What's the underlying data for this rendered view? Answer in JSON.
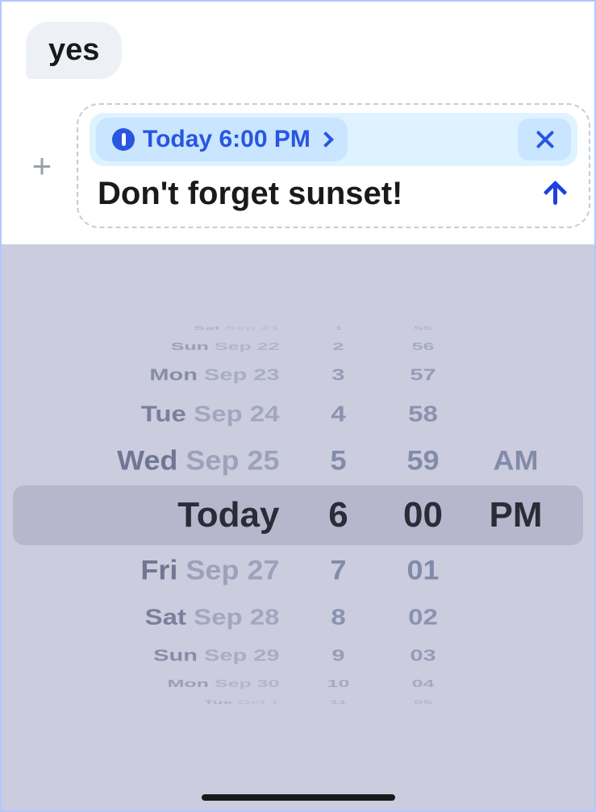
{
  "chat": {
    "incoming_message": "yes"
  },
  "compose": {
    "reminder_label": "Today 6:00 PM",
    "message": "Don't forget sunset!"
  },
  "picker": {
    "rows_before": [
      {
        "dow": "Sat",
        "md": "Sep 21",
        "hour": "1",
        "min": "55",
        "ampm": ""
      },
      {
        "dow": "Sun",
        "md": "Sep 22",
        "hour": "2",
        "min": "56",
        "ampm": ""
      },
      {
        "dow": "Mon",
        "md": "Sep 23",
        "hour": "3",
        "min": "57",
        "ampm": ""
      },
      {
        "dow": "Tue",
        "md": "Sep 24",
        "hour": "4",
        "min": "58",
        "ampm": ""
      },
      {
        "dow": "Wed",
        "md": "Sep 25",
        "hour": "5",
        "min": "59",
        "ampm": "AM"
      }
    ],
    "selected": {
      "date": "Today",
      "hour": "6",
      "min": "00",
      "ampm": "PM"
    },
    "rows_after": [
      {
        "dow": "Fri",
        "md": "Sep 27",
        "hour": "7",
        "min": "01",
        "ampm": ""
      },
      {
        "dow": "Sat",
        "md": "Sep 28",
        "hour": "8",
        "min": "02",
        "ampm": ""
      },
      {
        "dow": "Sun",
        "md": "Sep 29",
        "hour": "9",
        "min": "03",
        "ampm": ""
      },
      {
        "dow": "Mon",
        "md": "Sep 30",
        "hour": "10",
        "min": "04",
        "ampm": ""
      },
      {
        "dow": "Tue",
        "md": "Oct 1",
        "hour": "11",
        "min": "05",
        "ampm": ""
      }
    ]
  }
}
